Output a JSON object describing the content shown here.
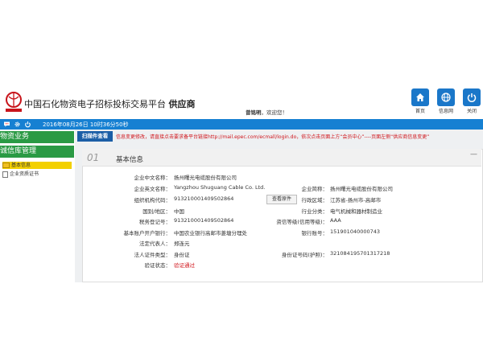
{
  "header": {
    "platform_title": "中国石化物资电子招标投标交易平台",
    "platform_suffix": "供应商",
    "user_name": "曾铭明",
    "greeting": "，欢迎您！"
  },
  "toolbar": {
    "home_label": "首页",
    "info_label": "信息网",
    "close_label": "关闭"
  },
  "statusbar": {
    "datetime": "2016年08月26日 10时36分50秒"
  },
  "sidebar": {
    "section1": "物资业务",
    "section2": "诚信库管理",
    "items": [
      {
        "label": "基本信息"
      },
      {
        "label": "企业资质证书"
      }
    ]
  },
  "tab": {
    "label": "扫描件查看"
  },
  "notice": "信息变更修改，请直接点击要求备平台链接http://mail.epec.com/ecmall/login.do，依次点击页面上方“会员中心”----页面左侧“供应商信息变更”",
  "panel": {
    "number": "01",
    "title": "基本信息",
    "minimize": "—",
    "attach_button": "查看原件"
  },
  "fields": {
    "cn_name_label": "企业中文名称：",
    "cn_name": "扬州曙光电缆股份有限公司",
    "en_name_label": "企业英文名称：",
    "en_name": "Yangzhou Shuguang Cable Co. Ltd.",
    "short_name_label": "企业简称：",
    "short_name": "扬州曙光电缆股份有限公司",
    "org_code_label": "组织机构代码：",
    "org_code": "913210001409502864",
    "region_label": "行政区域：",
    "region": "江苏省-扬州市-高邮市",
    "country_label": "国别/地区：",
    "country": "中国",
    "industry_label": "行业分类：",
    "industry": "电气机械和器材制造业",
    "tax_label": "税务登记号：",
    "tax": "913210001409502864",
    "credit_label": "资信等级(信用等级)：",
    "credit": "AAA",
    "bank_label": "基本账户开户银行：",
    "bank": "中国农业银行高邮市菱塘分理处",
    "account_label": "银行账号：",
    "account": "151901040000743",
    "legal_label": "法定代表人：",
    "legal": "郑连元",
    "id_type_label": "法人证件类型：",
    "id_type": "身份证",
    "id_no_label": "身份证号码(护照)：",
    "id_no": "321084195701317218",
    "verify_label": "验证状态：",
    "verify": "验证通过"
  },
  "colors": {
    "accent_blue": "#1680d2",
    "sidebar_green": "#2a9a44",
    "active_yellow": "#f3d000",
    "notice_red": "#d0151b",
    "tab_blue": "#1b5ea6"
  }
}
